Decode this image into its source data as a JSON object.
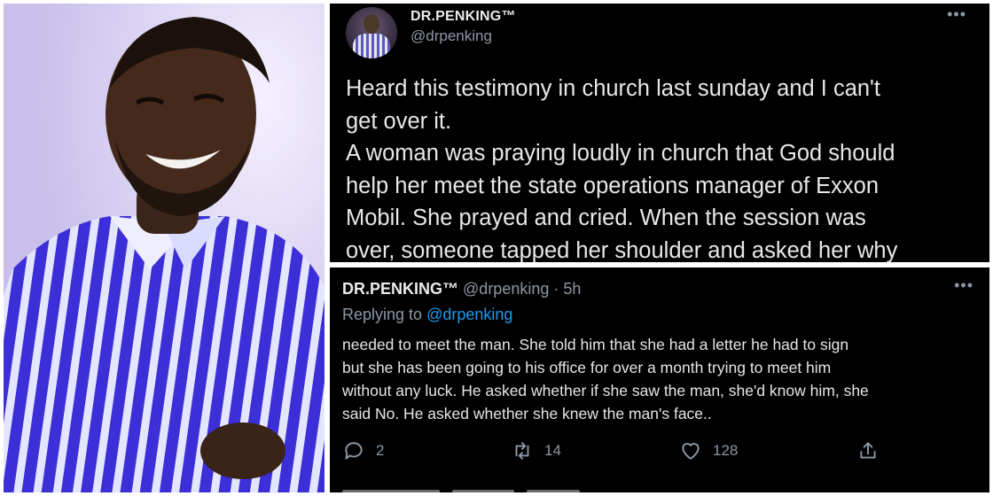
{
  "top_tweet": {
    "display_name": "DR.PENKING™",
    "handle": "@drpenking",
    "more_icon": "more-dots-icon",
    "lines": [
      "Heard this testimony in church last sunday and I can't",
      "get over it.",
      "A woman was praying loudly in church that God should",
      "help her meet the state operations manager of Exxon",
      "Mobil. She prayed and cried. When the session was",
      "over, someone tapped her shoulder and asked her why"
    ]
  },
  "reply_tweet": {
    "display_name": "DR.PENKING™",
    "handle": "@drpenking",
    "separator": "·",
    "time": "5h",
    "replying_prefix": "Replying to",
    "replying_mention": "@drpenking",
    "lines": [
      "needed to meet the man. She told him that she had a letter he had to sign",
      "but she has been going to his office for over a month trying to meet him",
      "without any luck. He asked whether if she saw the man, she'd know him, she",
      "said No. He asked whether she knew the man's face.."
    ],
    "actions": {
      "reply_count": "2",
      "retweet_count": "14",
      "like_count": "128"
    }
  },
  "colors": {
    "background": "#000000",
    "text": "#e8e8e8",
    "muted": "#8b98a5",
    "link": "#1d9bf0"
  }
}
